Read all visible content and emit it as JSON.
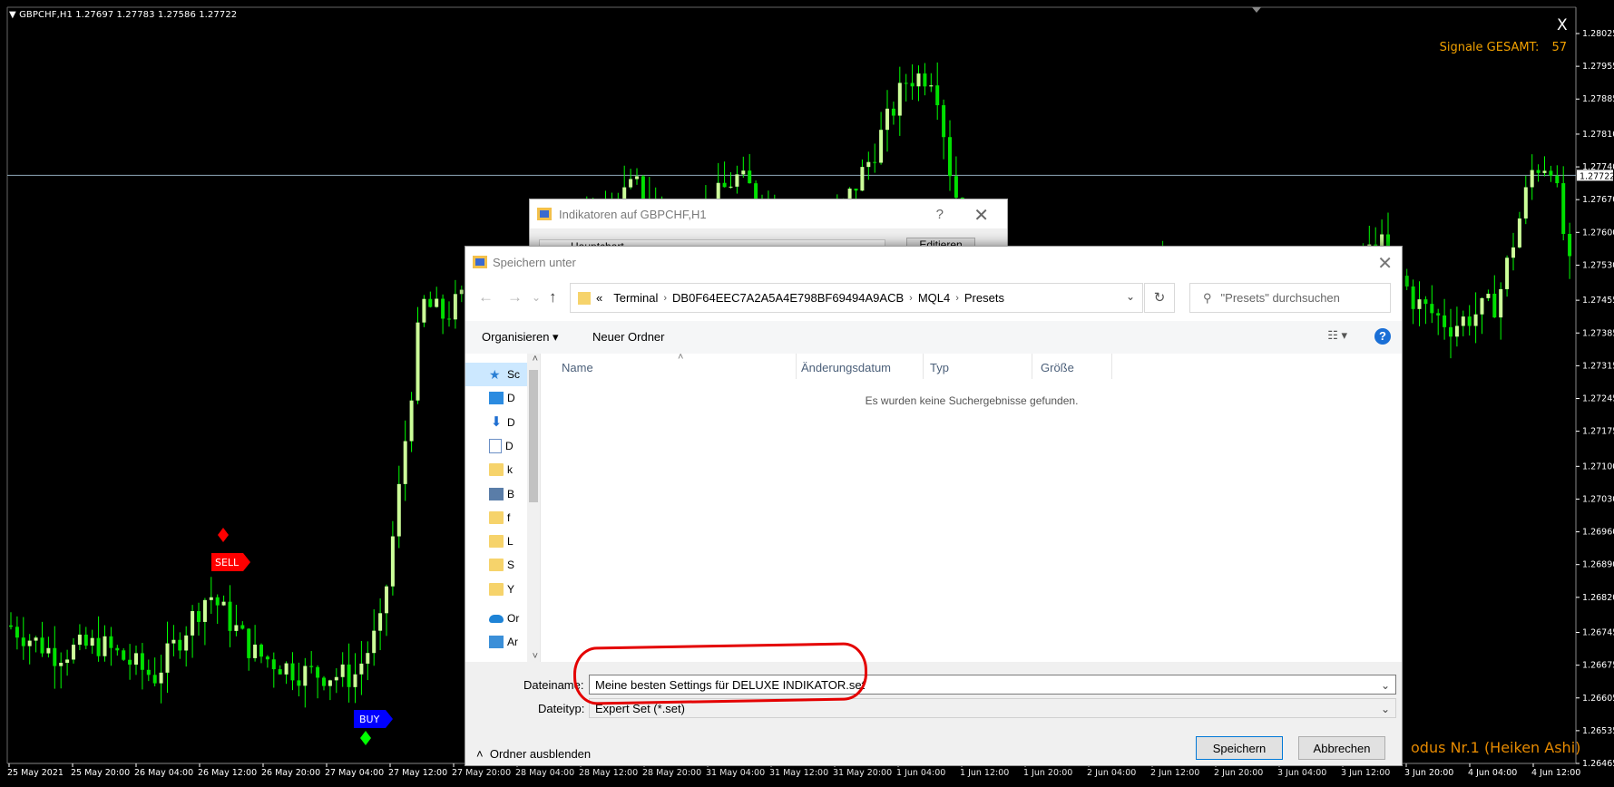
{
  "chart": {
    "header": "▼ GBPCHF,H1  1.27697 1.27783 1.27586 1.27722",
    "close_glyph": "X",
    "signals_label": "Signale GESAMT:",
    "signals_count": "57",
    "mode_label": "odus Nr.1 (Heiken Ashi)",
    "current_price": "1.27722",
    "price_ticks": [
      "1.28025",
      "1.27955",
      "1.27885",
      "1.27810",
      "1.27740",
      "1.27670",
      "1.27600",
      "1.27530",
      "1.27455",
      "1.27385",
      "1.27315",
      "1.27245",
      "1.27175",
      "1.27100",
      "1.27030",
      "1.26960",
      "1.26890",
      "1.26820",
      "1.26745",
      "1.26675",
      "1.26605",
      "1.26535",
      "1.26465"
    ],
    "time_ticks": [
      "25 May 2021",
      "25 May 20:00",
      "26 May 04:00",
      "26 May 12:00",
      "26 May 20:00",
      "27 May 04:00",
      "27 May 12:00",
      "27 May 20:00",
      "28 May 04:00",
      "28 May 12:00",
      "28 May 20:00",
      "31 May 04:00",
      "31 May 12:00",
      "31 May 20:00",
      "1 Jun 04:00",
      "1 Jun 12:00",
      "1 Jun 20:00",
      "2 Jun 04:00",
      "2 Jun 12:00",
      "2 Jun 20:00",
      "3 Jun 04:00",
      "3 Jun 12:00",
      "3 Jun 20:00",
      "4 Jun 04:00",
      "4 Jun 12:00"
    ],
    "sell_label": "SELL",
    "buy_label": "BUY",
    "colors": {
      "bull": "#ccff99",
      "bear": "#00e000",
      "wick": "#00ff00",
      "sell": "#ff0000",
      "buy": "#0000ff",
      "signals": "#f0a000"
    }
  },
  "indicator_dialog": {
    "title": "Indikatoren auf GBPCHF,H1",
    "help": "?",
    "close": "✕",
    "tree_item": "Hauptchart",
    "edit_button": "Editieren"
  },
  "save_dialog": {
    "title": "Speichern unter",
    "close": "✕",
    "nav": {
      "back": "←",
      "forward": "→",
      "recent": "⌄",
      "up": "↑"
    },
    "breadcrumb": [
      "«",
      "Terminal",
      "DB0F64EEC7A2A5A4E798BF69494A9ACB",
      "MQL4",
      "Presets"
    ],
    "breadcrumb_sep": "›",
    "refresh": "↻",
    "search_placeholder": "\"Presets\" durchsuchen",
    "organize": "Organisieren ▾",
    "new_folder": "Neuer Ordner",
    "view": "☷ ▾",
    "help": "?",
    "nav_items": [
      {
        "icon": "star",
        "label": "Sc"
      },
      {
        "icon": "desktop",
        "label": "D"
      },
      {
        "icon": "download",
        "label": "D"
      },
      {
        "icon": "doc",
        "label": "D"
      },
      {
        "icon": "folder",
        "label": "k"
      },
      {
        "icon": "pics",
        "label": "B"
      },
      {
        "icon": "folder",
        "label": "f"
      },
      {
        "icon": "folder",
        "label": "L"
      },
      {
        "icon": "folder",
        "label": "S"
      },
      {
        "icon": "folder",
        "label": "Y"
      },
      {
        "icon": "cloud",
        "label": "Or"
      },
      {
        "icon": "monitor",
        "label": "Ar"
      }
    ],
    "columns": [
      "Name",
      "Änderungsdatum",
      "Typ",
      "Größe"
    ],
    "empty_message": "Es wurden keine Suchergebnisse gefunden.",
    "filename_label": "Dateiname:",
    "filename_value": "Meine besten Settings für DELUXE INDIKATOR.set",
    "filetype_label": "Dateityp:",
    "filetype_value": "Expert Set (*.set)",
    "hide_folders": "Ordner ausblenden",
    "save_button": "Speichern",
    "cancel_button": "Abbrechen"
  }
}
